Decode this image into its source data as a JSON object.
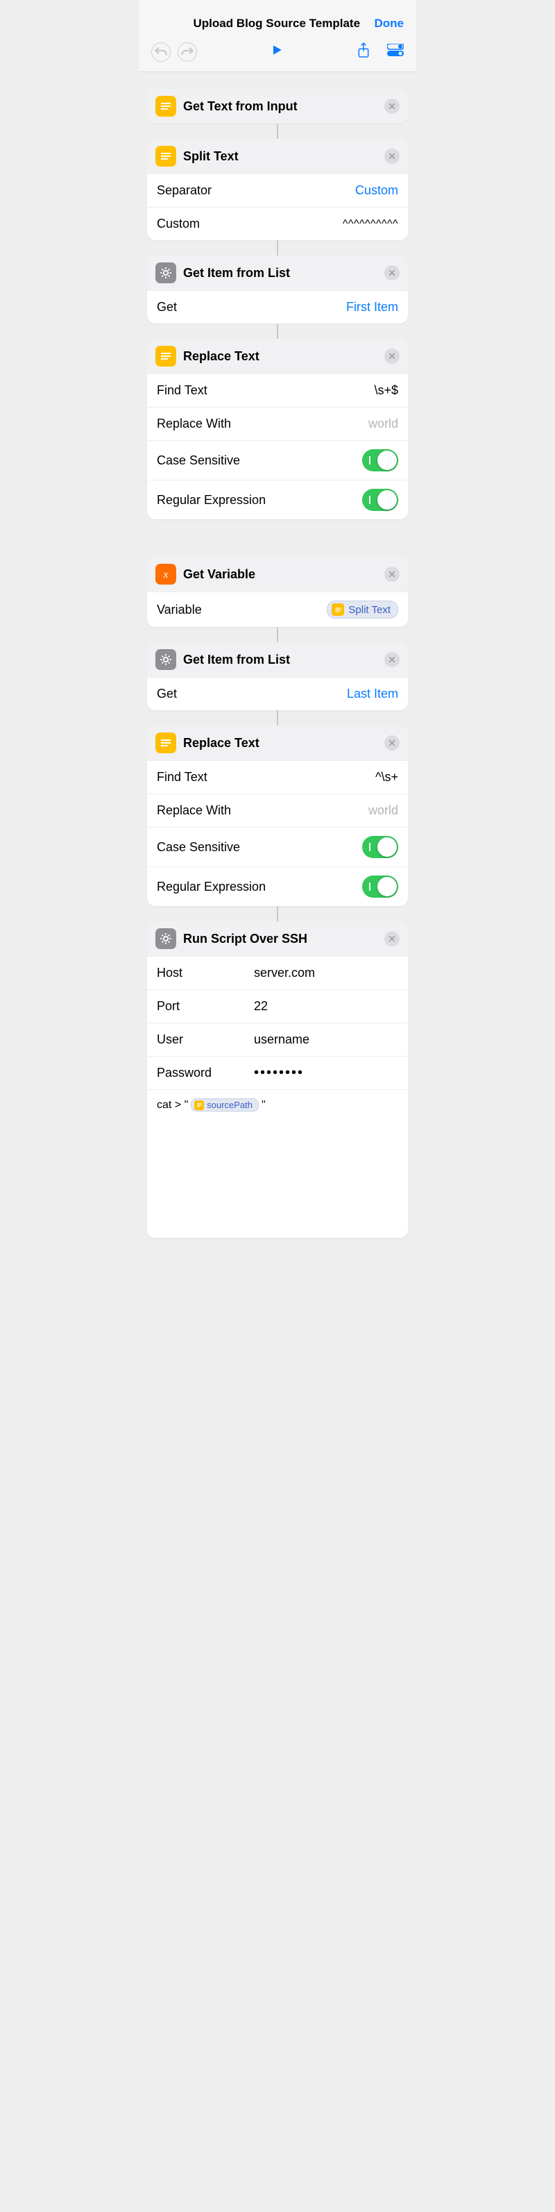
{
  "header": {
    "title": "Upload Blog Source Template",
    "done": "Done"
  },
  "actions": [
    {
      "id": "getText",
      "icon": "text-yellow",
      "title": "Get Text from Input",
      "rows": []
    },
    {
      "id": "splitText",
      "icon": "text-yellow",
      "title": "Split Text",
      "rows": [
        {
          "type": "link",
          "label": "Separator",
          "value": "Custom"
        },
        {
          "type": "mono",
          "label": "Custom",
          "value": "^^^^^^^^^^"
        }
      ]
    },
    {
      "id": "getItem1",
      "icon": "gear-gray",
      "title": "Get Item from List",
      "rows": [
        {
          "type": "link",
          "label": "Get",
          "value": "First Item"
        }
      ]
    },
    {
      "id": "replace1",
      "icon": "text-yellow",
      "title": "Replace Text",
      "rows": [
        {
          "type": "text",
          "label": "Find Text",
          "value": "\\s+$"
        },
        {
          "type": "placeholder",
          "label": "Replace With",
          "value": "world"
        },
        {
          "type": "toggle",
          "label": "Case Sensitive",
          "value": true
        },
        {
          "type": "toggle",
          "label": "Regular Expression",
          "value": true
        }
      ]
    },
    {
      "id": "getVar",
      "icon": "x-orange",
      "title": "Get Variable",
      "rows": [
        {
          "type": "varchip",
          "label": "Variable",
          "value": "Split Text"
        }
      ]
    },
    {
      "id": "getItem2",
      "icon": "gear-gray",
      "title": "Get Item from List",
      "rows": [
        {
          "type": "link",
          "label": "Get",
          "value": "Last Item"
        }
      ]
    },
    {
      "id": "replace2",
      "icon": "text-yellow",
      "title": "Replace Text",
      "rows": [
        {
          "type": "text",
          "label": "Find Text",
          "value": "^\\s+"
        },
        {
          "type": "placeholder",
          "label": "Replace With",
          "value": "world"
        },
        {
          "type": "toggle",
          "label": "Case Sensitive",
          "value": true
        },
        {
          "type": "toggle",
          "label": "Regular Expression",
          "value": true
        }
      ]
    },
    {
      "id": "ssh",
      "icon": "gear-gray",
      "title": "Run Script Over SSH",
      "rows": [
        {
          "type": "wtext",
          "label": "Host",
          "value": "server.com"
        },
        {
          "type": "wtext",
          "label": "Port",
          "value": "22"
        },
        {
          "type": "wtext",
          "label": "User",
          "value": "username"
        },
        {
          "type": "wpass",
          "label": "Password",
          "value": "••••••••"
        }
      ],
      "script": {
        "pre": "cat > \"",
        "var": "sourcePath",
        "post": "\""
      },
      "extraTall": true
    }
  ],
  "flow": [
    "card",
    "conn",
    "card",
    "conn",
    "card",
    "conn",
    "card",
    "gap",
    "card",
    "conn",
    "card",
    "conn",
    "card",
    "conn",
    "card"
  ]
}
